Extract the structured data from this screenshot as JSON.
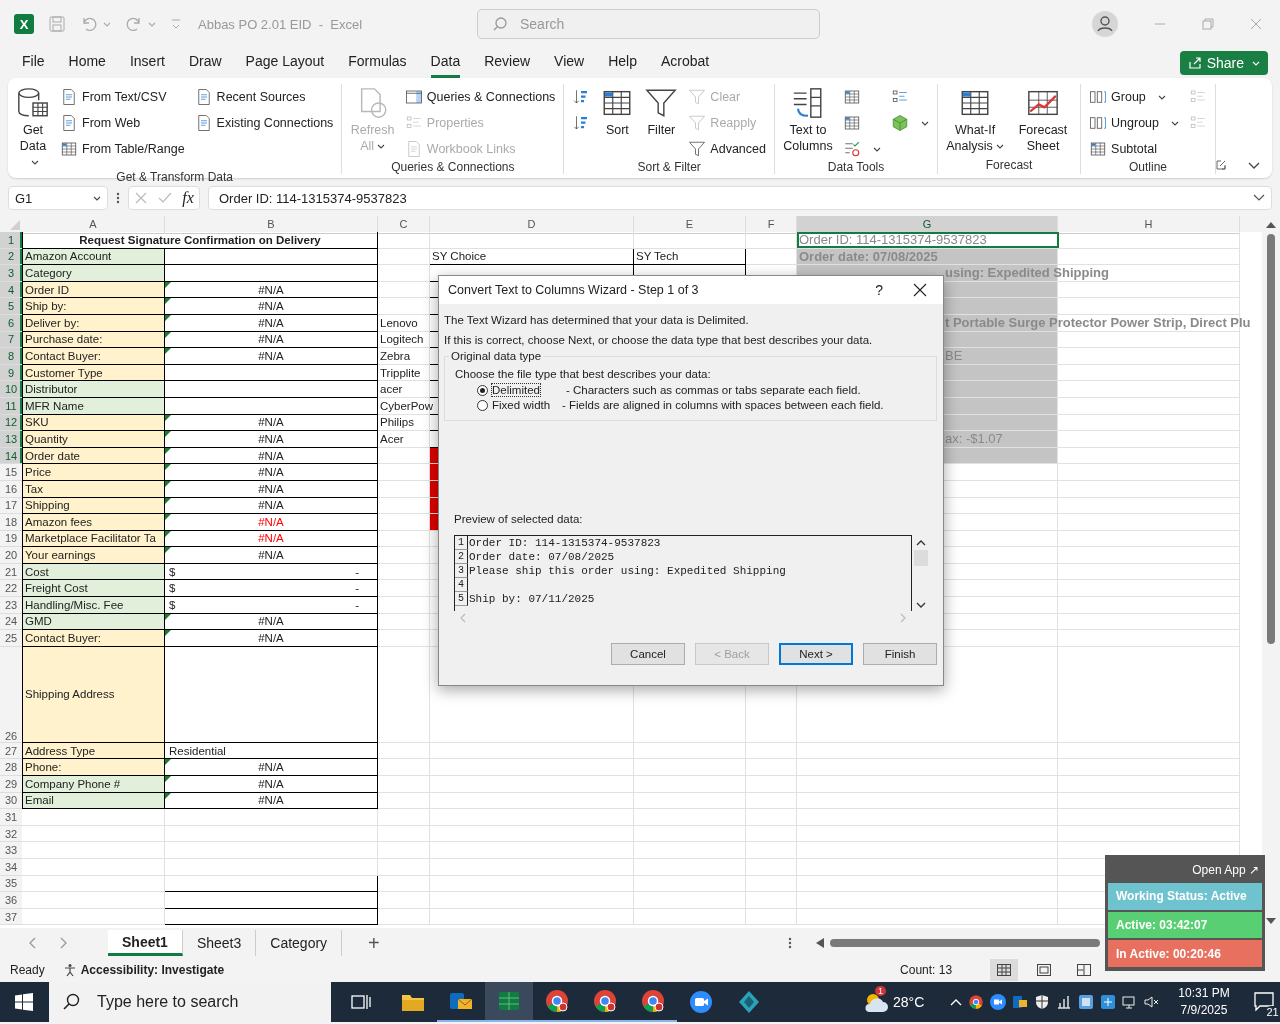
{
  "titlebar": {
    "app_badge": "X",
    "title": "Abbas PO 2.01 EID  -  Excel",
    "search_placeholder": "Search"
  },
  "menu": [
    {
      "label": "File",
      "selected": false
    },
    {
      "label": "Home",
      "selected": false
    },
    {
      "label": "Insert",
      "selected": false
    },
    {
      "label": "Draw",
      "selected": false
    },
    {
      "label": "Page Layout",
      "selected": false
    },
    {
      "label": "Formulas",
      "selected": false
    },
    {
      "label": "Data",
      "selected": true
    },
    {
      "label": "Review",
      "selected": false
    },
    {
      "label": "View",
      "selected": false
    },
    {
      "label": "Help",
      "selected": false
    },
    {
      "label": "Acrobat",
      "selected": false
    }
  ],
  "share": "Share",
  "ribbon": [
    {
      "title": "Get & Transform Data",
      "columns": [
        {
          "kind": "large",
          "label": "Get Data",
          "dropdown": true,
          "disabled": false
        },
        {
          "kind": "stack",
          "items": [
            {
              "label": "From Text/CSV",
              "dropdown": false,
              "disabled": false
            },
            {
              "label": "From Web",
              "dropdown": false,
              "disabled": false
            },
            {
              "label": "From Table/Range",
              "dropdown": false,
              "disabled": false
            }
          ]
        },
        {
          "kind": "stack",
          "items": [
            {
              "label": "Recent Sources",
              "dropdown": false,
              "disabled": false
            },
            {
              "label": "Existing Connections",
              "dropdown": false,
              "disabled": false
            }
          ]
        }
      ]
    },
    {
      "title": "Queries & Connections",
      "columns": [
        {
          "kind": "large",
          "label": "Refresh All",
          "dropdown": true,
          "disabled": true
        },
        {
          "kind": "stack",
          "items": [
            {
              "label": "Queries & Connections",
              "dropdown": false,
              "disabled": false
            },
            {
              "label": "Properties",
              "dropdown": false,
              "disabled": true
            },
            {
              "label": "Workbook Links",
              "dropdown": false,
              "disabled": true
            }
          ]
        }
      ]
    },
    {
      "title": "Sort & Filter",
      "columns": [
        {
          "kind": "stack",
          "items": [
            {
              "dropdown": false,
              "disabled": false
            },
            {
              "dropdown": false,
              "disabled": false
            }
          ]
        },
        {
          "kind": "large",
          "label": "Sort",
          "dropdown": false,
          "disabled": false
        },
        {
          "kind": "large",
          "label": "Filter",
          "dropdown": false,
          "disabled": false
        },
        {
          "kind": "stack",
          "items": [
            {
              "label": "Clear",
              "dropdown": false,
              "disabled": true
            },
            {
              "label": "Reapply",
              "dropdown": false,
              "disabled": true
            },
            {
              "label": "Advanced",
              "dropdown": false,
              "disabled": false
            }
          ]
        }
      ]
    },
    {
      "title": "Data Tools",
      "columns": [
        {
          "kind": "large",
          "label": "Text to Columns",
          "dropdown": false,
          "disabled": false
        },
        {
          "kind": "stack",
          "items": [
            {
              "dropdown": false,
              "disabled": false
            },
            {
              "dropdown": false,
              "disabled": false
            },
            {
              "dropdown": true,
              "disabled": false
            }
          ]
        },
        {
          "kind": "stack",
          "items": [
            {
              "dropdown": false,
              "disabled": false
            },
            {
              "dropdown": true,
              "disabled": false
            }
          ]
        }
      ]
    },
    {
      "title": "Forecast",
      "columns": [
        {
          "kind": "large",
          "label": "What-If Analysis",
          "dropdown": true,
          "disabled": false
        },
        {
          "kind": "large",
          "label": "Forecast Sheet",
          "dropdown": false,
          "disabled": false
        }
      ]
    },
    {
      "title": "Outline",
      "columns": [
        {
          "kind": "stack",
          "items": [
            {
              "label": "Group",
              "dropdown": true,
              "disabled": false
            },
            {
              "label": "Ungroup",
              "dropdown": true,
              "disabled": false
            },
            {
              "label": "Subtotal",
              "dropdown": false,
              "disabled": false
            }
          ]
        },
        {
          "kind": "stack",
          "items": [
            {
              "dropdown": false,
              "disabled": true
            },
            {
              "dropdown": false,
              "disabled": true
            }
          ]
        }
      ]
    }
  ],
  "formula_bar": {
    "name_box": "G1",
    "fx": "fx",
    "formula": "Order ID: 114-1315374-9537823"
  },
  "sheet": {
    "columns": [
      {
        "label": "A",
        "selected": false
      },
      {
        "label": "B",
        "selected": false
      },
      {
        "label": "C",
        "selected": false
      },
      {
        "label": "D",
        "selected": false
      },
      {
        "label": "E",
        "selected": false
      },
      {
        "label": "F",
        "selected": false
      },
      {
        "label": "G",
        "selected": true
      },
      {
        "label": "H",
        "selected": false
      }
    ],
    "rows": [
      {
        "num": "1",
        "selected": true,
        "title": "Request Signature Confirmation on Delivery",
        "cells": {
          "g": {
            "text": "Order ID: 114-1315374-9537823",
            "active": true,
            "bold": false,
            "partial": false
          }
        }
      },
      {
        "num": "2",
        "selected": true,
        "cells": {
          "a": {
            "text": "Amazon Account",
            "color": "#e2efda"
          },
          "d": {
            "text": "SY Choice"
          },
          "e": {
            "text": "SY Tech"
          },
          "g": {
            "text": "Order date: 07/08/2025",
            "active": false,
            "bold": true,
            "partial": false
          }
        }
      },
      {
        "num": "3",
        "selected": true,
        "cells": {
          "a": {
            "text": "Category",
            "color": "#e2efda"
          },
          "g": {
            "text": "using: Expedited Shipping",
            "active": false,
            "bold": true,
            "partial": true
          }
        }
      },
      {
        "num": "4",
        "selected": true,
        "cells": {
          "a": {
            "text": "Order ID",
            "color": "#fff2cc"
          },
          "b": {
            "text": "#N/A",
            "flagged": true,
            "alert": false
          }
        }
      },
      {
        "num": "5",
        "selected": true,
        "cells": {
          "a": {
            "text": "Ship by:",
            "color": "#fff2cc"
          },
          "b": {
            "text": "#N/A",
            "flagged": true,
            "alert": false
          }
        }
      },
      {
        "num": "6",
        "selected": true,
        "cells": {
          "a": {
            "text": "Deliver by:",
            "color": "#fff2cc"
          },
          "b": {
            "text": "#N/A",
            "flagged": true,
            "alert": false
          },
          "c": {
            "text": "Lenovo"
          },
          "g": {
            "text": "t Portable Surge Protector Power Strip, Direct Plu",
            "active": false,
            "bold": true,
            "partial": true
          }
        }
      },
      {
        "num": "7",
        "selected": true,
        "cells": {
          "a": {
            "text": "Purchase date:",
            "color": "#fff2cc"
          },
          "b": {
            "text": "#N/A",
            "flagged": true,
            "alert": false
          },
          "c": {
            "text": "Logitech"
          }
        }
      },
      {
        "num": "8",
        "selected": true,
        "cells": {
          "a": {
            "text": "Contact Buyer:",
            "color": "#fff2cc"
          },
          "b": {
            "text": "#N/A",
            "flagged": true,
            "alert": false
          },
          "c": {
            "text": "Zebra"
          },
          "g": {
            "text": "BE",
            "active": false,
            "bold": false,
            "partial": true
          }
        }
      },
      {
        "num": "9",
        "selected": true,
        "cells": {
          "a": {
            "text": "Customer Type",
            "color": "#fff2cc"
          },
          "c": {
            "text": "Tripplite"
          }
        }
      },
      {
        "num": "10",
        "selected": true,
        "cells": {
          "a": {
            "text": "Distributor",
            "color": "#e2efda"
          },
          "c": {
            "text": "acer"
          }
        }
      },
      {
        "num": "11",
        "selected": true,
        "cells": {
          "a": {
            "text": "MFR Name",
            "color": "#e2efda"
          },
          "c": {
            "text": "CyberPow"
          }
        }
      },
      {
        "num": "12",
        "selected": true,
        "cells": {
          "a": {
            "text": "SKU",
            "color": "#fff2cc"
          },
          "b": {
            "text": "#N/A",
            "flagged": true,
            "alert": false
          },
          "c": {
            "text": "Philips"
          }
        }
      },
      {
        "num": "13",
        "selected": true,
        "cells": {
          "a": {
            "text": "Quantity",
            "color": "#fff2cc"
          },
          "b": {
            "text": "#N/A",
            "flagged": true,
            "alert": false
          },
          "c": {
            "text": "Acer"
          },
          "g": {
            "text": "ax: -$1.07",
            "active": false,
            "bold": false,
            "partial": true
          }
        }
      },
      {
        "num": "14",
        "selected": true,
        "cells": {
          "a": {
            "text": "Order date",
            "color": "#fff2cc"
          },
          "b": {
            "text": "#N/A",
            "flagged": true,
            "alert": false
          },
          "d": {
            "color": "#e00000"
          }
        }
      },
      {
        "num": "15",
        "selected": false,
        "cells": {
          "a": {
            "text": "Price",
            "color": "#fff2cc"
          },
          "b": {
            "text": "#N/A",
            "flagged": true,
            "alert": false
          },
          "d": {
            "color": "#e00000"
          }
        }
      },
      {
        "num": "16",
        "selected": false,
        "cells": {
          "a": {
            "text": "Tax",
            "color": "#fff2cc"
          },
          "b": {
            "text": "#N/A",
            "flagged": true,
            "alert": false
          },
          "d": {
            "color": "#e00000"
          }
        }
      },
      {
        "num": "17",
        "selected": false,
        "cells": {
          "a": {
            "text": "Shipping",
            "color": "#fff2cc"
          },
          "b": {
            "text": "#N/A",
            "flagged": true,
            "alert": false
          },
          "d": {
            "color": "#e00000"
          }
        }
      },
      {
        "num": "18",
        "selected": false,
        "cells": {
          "a": {
            "text": "Amazon fees",
            "color": "#fff2cc"
          },
          "b": {
            "text": "#N/A",
            "flagged": true,
            "alert": true
          },
          "d": {
            "color": "#e00000"
          }
        }
      },
      {
        "num": "19",
        "selected": false,
        "cells": {
          "a": {
            "text": "Marketplace Facilitator Ta",
            "color": "#fff2cc"
          },
          "b": {
            "text": "#N/A",
            "flagged": true,
            "alert": true
          }
        }
      },
      {
        "num": "20",
        "selected": false,
        "cells": {
          "a": {
            "text": "Your earnings",
            "color": "#fff2cc"
          },
          "b": {
            "text": "#N/A",
            "flagged": true,
            "alert": false
          }
        }
      },
      {
        "num": "21",
        "selected": false,
        "cells": {
          "a": {
            "text": "Cost",
            "color": "#e2efda"
          },
          "b": {
            "text": "$",
            "value": "-",
            "flagged": false,
            "alert": false
          }
        }
      },
      {
        "num": "22",
        "selected": false,
        "cells": {
          "a": {
            "text": "Freight Cost",
            "color": "#e2efda"
          },
          "b": {
            "text": "$",
            "value": "-",
            "flagged": false,
            "alert": false
          }
        }
      },
      {
        "num": "23",
        "selected": false,
        "cells": {
          "a": {
            "text": "Handling/Misc. Fee",
            "color": "#e2efda"
          },
          "b": {
            "text": "$",
            "value": "-",
            "flagged": false,
            "alert": false
          }
        }
      },
      {
        "num": "24",
        "selected": false,
        "cells": {
          "a": {
            "text": "GMD",
            "color": "#e2efda"
          },
          "b": {
            "text": "#N/A",
            "flagged": true,
            "alert": false
          }
        }
      },
      {
        "num": "25",
        "selected": false,
        "cells": {
          "a": {
            "text": "Contact Buyer:",
            "color": "#fff2cc"
          },
          "b": {
            "text": "#N/A",
            "flagged": true,
            "alert": false
          }
        }
      },
      {
        "num": "26",
        "selected": false,
        "cells": {
          "a": {
            "text": "Shipping Address",
            "color": "#fff2cc"
          }
        }
      },
      {
        "num": "27",
        "selected": false,
        "cells": {
          "a": {
            "text": "Address Type",
            "color": "#fff2cc"
          },
          "b": {
            "text": "Residential",
            "flagged": false,
            "alert": false
          }
        }
      },
      {
        "num": "28",
        "selected": false,
        "cells": {
          "a": {
            "text": "Phone:",
            "color": "#fff2cc"
          },
          "b": {
            "text": "#N/A",
            "flagged": true,
            "alert": false
          }
        }
      },
      {
        "num": "29",
        "selected": false,
        "cells": {
          "a": {
            "text": "Company Phone #",
            "color": "#e2efda"
          },
          "b": {
            "text": "#N/A",
            "flagged": true,
            "alert": false
          }
        }
      },
      {
        "num": "30",
        "selected": false,
        "cells": {
          "a": {
            "text": "Email",
            "color": "#e2efda"
          },
          "b": {
            "text": "#N/A",
            "flagged": true,
            "alert": false
          }
        }
      },
      {
        "num": "31",
        "selected": false
      },
      {
        "num": "32",
        "selected": false
      },
      {
        "num": "33",
        "selected": false
      },
      {
        "num": "34",
        "selected": false
      },
      {
        "num": "35",
        "selected": false
      },
      {
        "num": "36",
        "selected": false
      },
      {
        "num": "37",
        "selected": false
      }
    ]
  },
  "dialog": {
    "title": "Convert Text to Columns Wizard - Step 1 of 3",
    "help": "?",
    "intro": "The Text Wizard has determined that your data is Delimited.",
    "hint": "If this is correct, choose Next, or choose the data type that best describes your data.",
    "group_title": "Original data type",
    "prompt": "Choose the file type that best describes your data:",
    "options": [
      {
        "label": "Delimited",
        "description": "- Characters such as commas or tabs separate each field.",
        "selected": true
      },
      {
        "label": "Fixed width",
        "description": "- Fields are aligned in columns with spaces between each field.",
        "selected": false
      }
    ],
    "preview_title": "Preview of selected data:",
    "preview": [
      {
        "num": "1",
        "text": "Order ID: 114-1315374-9537823"
      },
      {
        "num": "2",
        "text": "Order date: 07/08/2025"
      },
      {
        "num": "3",
        "text": "Please ship this order using: Expedited Shipping"
      },
      {
        "num": "4"
      },
      {
        "num": "5",
        "text": "Ship by: 07/11/2025"
      }
    ],
    "buttons": [
      {
        "label": "Cancel",
        "disabled": false,
        "default": false
      },
      {
        "label": "< Back",
        "disabled": true,
        "default": false
      },
      {
        "label": "Next >",
        "disabled": false,
        "default": true
      },
      {
        "label": "Finish",
        "disabled": false,
        "default": false
      }
    ]
  },
  "sheet_tabs": [
    {
      "label": "Sheet1",
      "selected": true
    },
    {
      "label": "Sheet3",
      "selected": false
    },
    {
      "label": "Category",
      "selected": false
    }
  ],
  "add_sheet": "+",
  "status_bar": {
    "ready": "Ready",
    "accessibility": "Accessibility: Investigate",
    "count": "Count: 13",
    "views": [
      {
        "selected": true
      },
      {
        "selected": false
      },
      {
        "selected": false
      }
    ]
  },
  "tracker": {
    "open_label": "Open App ↗",
    "rows": [
      {
        "text": "Working Status: Active",
        "color": "#6fc3cf"
      },
      {
        "text": "Active: 03:42:07",
        "color": "#57cf72"
      },
      {
        "text": "In Active: 00:20:46",
        "color": "#e8705f"
      }
    ]
  },
  "taskbar": {
    "search_placeholder": "Type here to search",
    "apps": [
      {
        "running": false,
        "selected": false
      },
      {
        "running": true,
        "selected": false
      },
      {
        "running": true,
        "selected": true
      },
      {
        "running": true,
        "selected": false
      },
      {
        "running": true,
        "selected": false
      },
      {
        "running": true,
        "selected": false
      },
      {
        "running": false,
        "selected": false
      },
      {
        "running": false,
        "selected": false
      }
    ],
    "weather_badge": "1",
    "temperature": "28°C",
    "time": "10:31 PM",
    "date": "7/9/2025",
    "notifications": "21"
  }
}
